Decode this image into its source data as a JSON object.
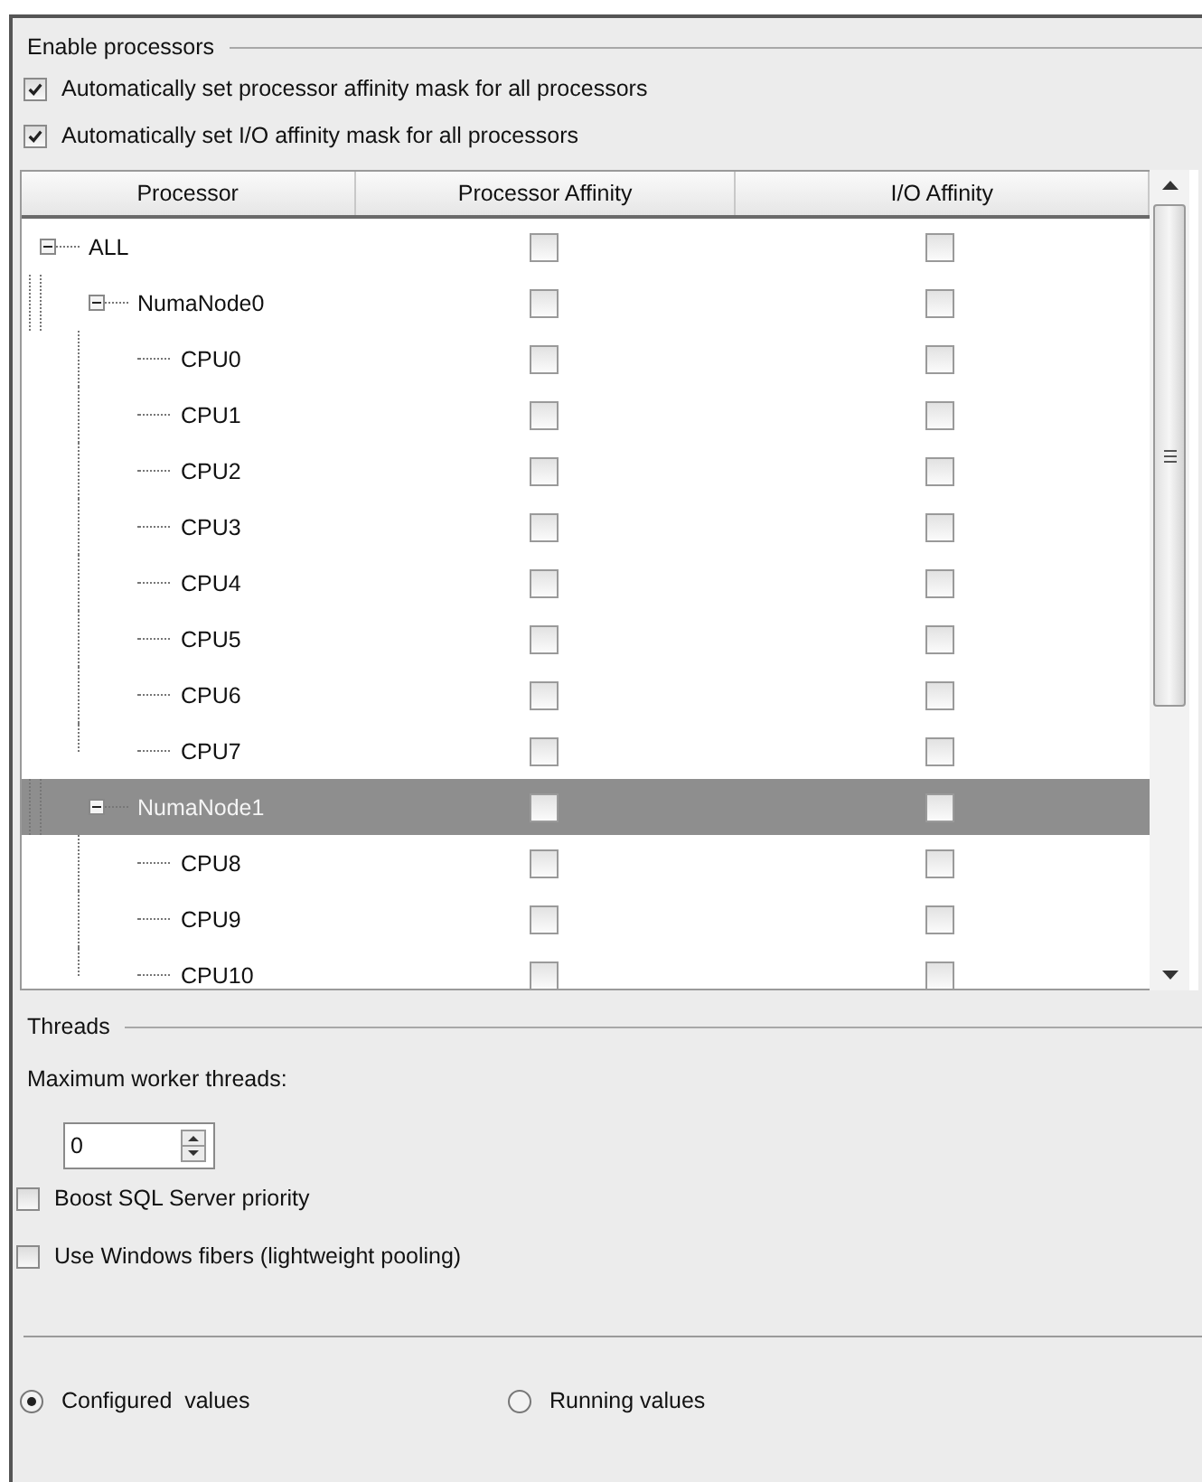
{
  "enable_processors": {
    "title": "Enable processors",
    "options": [
      {
        "label": "Automatically set processor affinity mask for all processors",
        "checked": true
      },
      {
        "label": "Automatically set I/O affinity mask for all processors",
        "checked": true
      }
    ]
  },
  "grid": {
    "columns": [
      "Processor",
      "Processor Affinity",
      "I/O Affinity"
    ],
    "rows": [
      {
        "label": "ALL",
        "expanded": true,
        "selected": false,
        "processor_affinity": false,
        "io_affinity": false,
        "children": [
          {
            "label": "NumaNode0",
            "expanded": true,
            "selected": false,
            "processor_affinity": false,
            "io_affinity": false,
            "children": [
              {
                "label": "CPU0",
                "selected": false,
                "processor_affinity": false,
                "io_affinity": false
              },
              {
                "label": "CPU1",
                "selected": false,
                "processor_affinity": false,
                "io_affinity": false
              },
              {
                "label": "CPU2",
                "selected": false,
                "processor_affinity": false,
                "io_affinity": false
              },
              {
                "label": "CPU3",
                "selected": false,
                "processor_affinity": false,
                "io_affinity": false
              },
              {
                "label": "CPU4",
                "selected": false,
                "processor_affinity": false,
                "io_affinity": false
              },
              {
                "label": "CPU5",
                "selected": false,
                "processor_affinity": false,
                "io_affinity": false
              },
              {
                "label": "CPU6",
                "selected": false,
                "processor_affinity": false,
                "io_affinity": false
              },
              {
                "label": "CPU7",
                "selected": false,
                "processor_affinity": false,
                "io_affinity": false
              }
            ]
          },
          {
            "label": "NumaNode1",
            "expanded": true,
            "selected": true,
            "processor_affinity": false,
            "io_affinity": false,
            "children": [
              {
                "label": "CPU8",
                "selected": false,
                "processor_affinity": false,
                "io_affinity": false
              },
              {
                "label": "CPU9",
                "selected": false,
                "processor_affinity": false,
                "io_affinity": false
              },
              {
                "label": "CPU10",
                "selected": false,
                "processor_affinity": false,
                "io_affinity": false
              }
            ]
          }
        ]
      }
    ]
  },
  "threads": {
    "title": "Threads",
    "max_worker_label": "Maximum worker threads:",
    "max_worker_value": "0",
    "options": [
      {
        "label": "Boost SQL Server priority",
        "checked": false
      },
      {
        "label": "Use Windows fibers (lightweight pooling)",
        "checked": false
      }
    ]
  },
  "view": [
    {
      "label": "Configured  values",
      "selected": true
    },
    {
      "label": "Running values",
      "selected": false
    }
  ]
}
